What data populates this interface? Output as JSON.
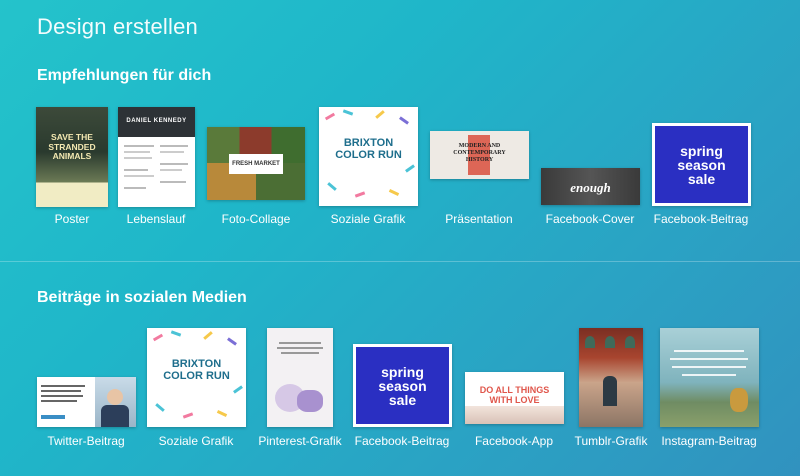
{
  "page": {
    "title": "Design erstellen"
  },
  "sections": {
    "recommended": {
      "title": "Empfehlungen für dich"
    },
    "social": {
      "title": "Beiträge in sozialen Medien"
    }
  },
  "recommended_items": [
    {
      "label": "Poster",
      "thumb_text": [
        "SAVE THE",
        "STRANDED",
        "ANIMALS"
      ]
    },
    {
      "label": "Lebenslauf",
      "thumb_text": [
        "DANIEL KENNEDY"
      ]
    },
    {
      "label": "Foto-Collage",
      "thumb_text": [
        "FRESH MARKET"
      ]
    },
    {
      "label": "Soziale Grafik",
      "thumb_text": [
        "BRIXTON",
        "COLOR RUN"
      ]
    },
    {
      "label": "Präsentation",
      "thumb_text": [
        "MODERN AND",
        "CONTEMPORARY",
        "HISTORY"
      ]
    },
    {
      "label": "Facebook-Cover",
      "thumb_text": [
        "enough"
      ]
    },
    {
      "label": "Facebook-Beitrag",
      "thumb_text": [
        "spring",
        "season",
        "sale"
      ]
    }
  ],
  "social_items": [
    {
      "label": "Twitter-Beitrag"
    },
    {
      "label": "Soziale Grafik",
      "thumb_text": [
        "BRIXTON",
        "COLOR RUN"
      ]
    },
    {
      "label": "Pinterest-Grafik"
    },
    {
      "label": "Facebook-Beitrag",
      "thumb_text": [
        "spring",
        "season",
        "sale"
      ]
    },
    {
      "label": "Facebook-App",
      "thumb_text": [
        "DO ALL THINGS",
        "WITH LOVE"
      ]
    },
    {
      "label": "Tumblr-Grafik"
    },
    {
      "label": "Instagram-Beitrag"
    }
  ],
  "colors": {
    "bg_start": "#24c3cb",
    "bg_end": "#3192bf",
    "spring_blue": "#2a2fc2",
    "run_teal": "#1e6e8c",
    "pres_red": "#d94f3d"
  }
}
